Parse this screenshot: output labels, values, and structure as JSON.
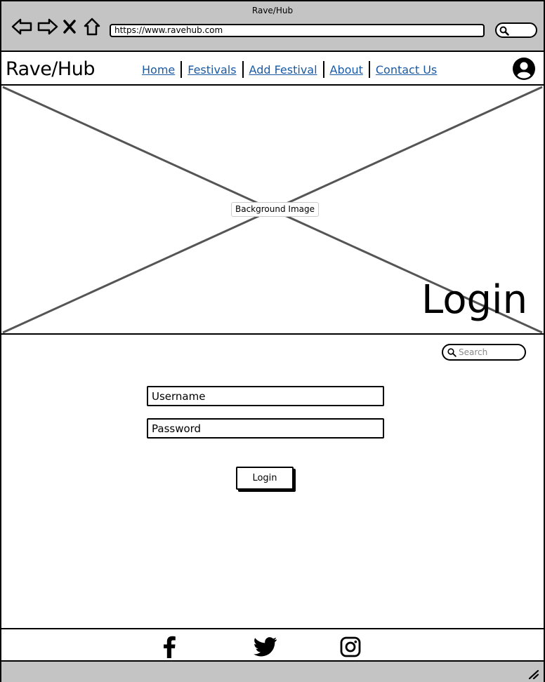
{
  "browser": {
    "title": "Rave/Hub",
    "url": "https://www.ravehub.com"
  },
  "header": {
    "logo": "Rave/Hub",
    "nav": [
      {
        "label": "Home"
      },
      {
        "label": "Festivals"
      },
      {
        "label": "Add Festival"
      },
      {
        "label": "About"
      },
      {
        "label": "Contact Us"
      }
    ]
  },
  "hero": {
    "image_label": "Background Image",
    "title": "Login"
  },
  "content": {
    "search": {
      "placeholder": "Search"
    },
    "username": {
      "placeholder": "Username"
    },
    "password": {
      "placeholder": "Password"
    },
    "login_button": "Login"
  },
  "footer": {
    "icons": [
      "facebook-icon",
      "twitter-icon",
      "instagram-icon"
    ]
  },
  "colors": {
    "chrome": "#c4c4c4",
    "link": "#1a5aa5"
  }
}
